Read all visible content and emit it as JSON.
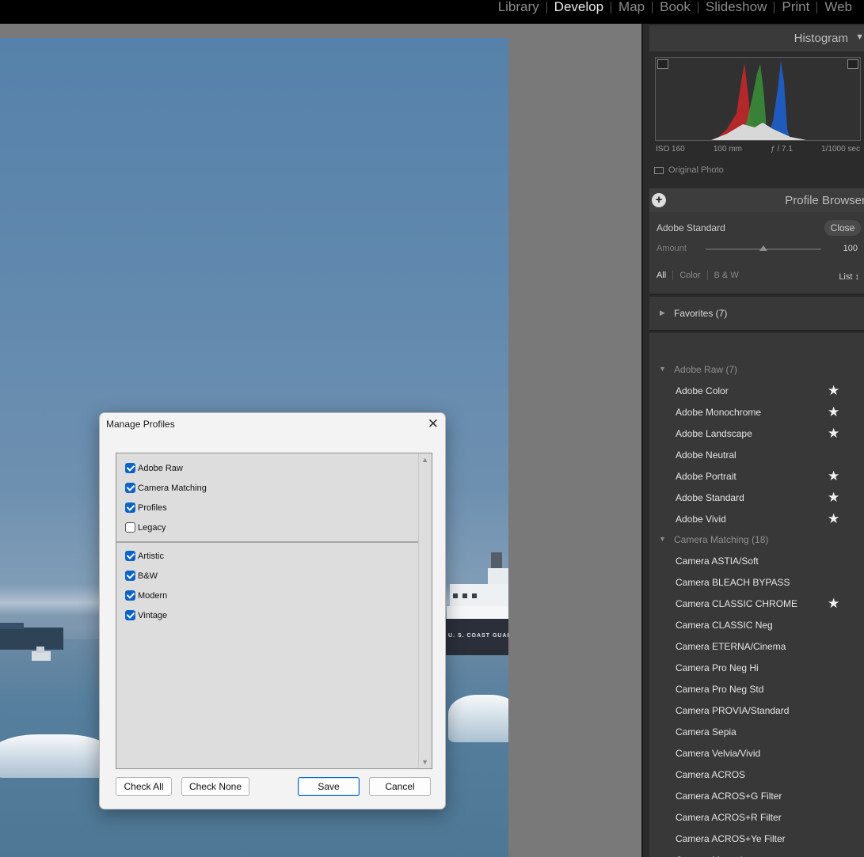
{
  "modules": [
    {
      "label": "Library",
      "active": false
    },
    {
      "label": "Develop",
      "active": true
    },
    {
      "label": "Map",
      "active": false
    },
    {
      "label": "Book",
      "active": false
    },
    {
      "label": "Slideshow",
      "active": false
    },
    {
      "label": "Print",
      "active": false
    },
    {
      "label": "Web",
      "active": false
    }
  ],
  "histogram": {
    "title": "Histogram",
    "iso": "ISO 160",
    "focal": "100 mm",
    "aperture": "ƒ / 7.1",
    "shutter": "1/1000 sec",
    "original_photo": "Original Photo"
  },
  "profile_browser": {
    "title": "Profile Browser",
    "current": "Adobe Standard",
    "close": "Close",
    "amount_label": "Amount",
    "amount_value": "100",
    "amount_fraction": 0.5,
    "filters": [
      "All",
      "Color",
      "B & W"
    ],
    "list_selector": "List ↕",
    "favorites": "Favorites (7)",
    "groups": [
      {
        "label": "Adobe Raw (7)",
        "items": [
          {
            "label": "Adobe Color",
            "fav": true
          },
          {
            "label": "Adobe Monochrome",
            "fav": true
          },
          {
            "label": "Adobe Landscape",
            "fav": true
          },
          {
            "label": "Adobe Neutral",
            "fav": false
          },
          {
            "label": "Adobe Portrait",
            "fav": true
          },
          {
            "label": "Adobe Standard",
            "fav": true
          },
          {
            "label": "Adobe Vivid",
            "fav": true
          }
        ]
      },
      {
        "label": "Camera Matching (18)",
        "items": [
          {
            "label": "Camera ASTIA/Soft",
            "fav": false
          },
          {
            "label": "Camera BLEACH BYPASS",
            "fav": false
          },
          {
            "label": "Camera CLASSIC CHROME",
            "fav": true
          },
          {
            "label": "Camera CLASSIC Neg",
            "fav": false
          },
          {
            "label": "Camera ETERNA/Cinema",
            "fav": false
          },
          {
            "label": "Camera Pro Neg Hi",
            "fav": false
          },
          {
            "label": "Camera Pro Neg Std",
            "fav": false
          },
          {
            "label": "Camera PROVIA/Standard",
            "fav": false
          },
          {
            "label": "Camera Sepia",
            "fav": false
          },
          {
            "label": "Camera Velvia/Vivid",
            "fav": false
          },
          {
            "label": "Camera ACROS",
            "fav": false
          },
          {
            "label": "Camera ACROS+G Filter",
            "fav": false
          },
          {
            "label": "Camera ACROS+R Filter",
            "fav": false
          },
          {
            "label": "Camera ACROS+Ye Filter",
            "fav": false
          },
          {
            "label": "Camera Monochrome",
            "fav": false
          }
        ]
      }
    ]
  },
  "dialog": {
    "title": "Manage Profiles",
    "close": "✕",
    "group1": [
      {
        "label": "Adobe Raw",
        "checked": true
      },
      {
        "label": "Camera Matching",
        "checked": true
      },
      {
        "label": "Profiles",
        "checked": true
      },
      {
        "label": "Legacy",
        "checked": false
      }
    ],
    "group2": [
      {
        "label": "Artistic",
        "checked": true
      },
      {
        "label": "B&W",
        "checked": true
      },
      {
        "label": "Modern",
        "checked": true
      },
      {
        "label": "Vintage",
        "checked": true
      }
    ],
    "check_all": "Check All",
    "check_none": "Check None",
    "save": "Save",
    "cancel": "Cancel"
  },
  "photo": {
    "ship_text": "U. S. COAST GUARD"
  }
}
